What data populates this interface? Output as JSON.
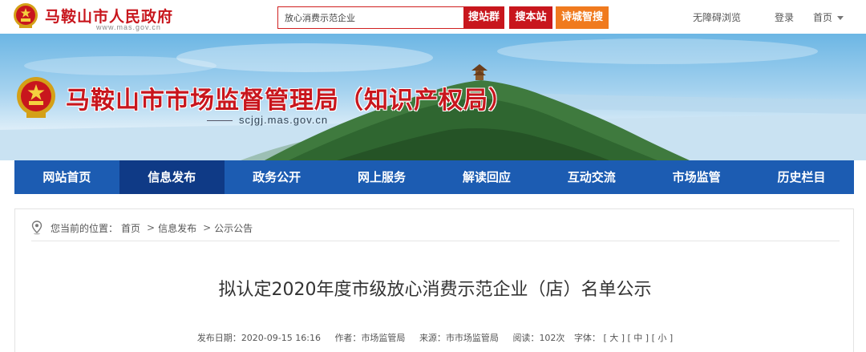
{
  "header": {
    "site_name": "马鞍山市人民政府",
    "site_domain": "www.mas.gov.cn",
    "search_value": "放心消费示范企业",
    "search_button": "搜站群",
    "site_search_button": "搜本站",
    "poetry_search_button": "诗城智搜",
    "accessibility_link": "无障碍浏览",
    "login_link": "登录",
    "home_link": "首页"
  },
  "banner": {
    "bureau_name": "马鞍山市市场监督管理局（知识产权局）",
    "bureau_domain": "scjgj.mas.gov.cn"
  },
  "nav": {
    "items": [
      {
        "label": "网站首页"
      },
      {
        "label": "信息发布"
      },
      {
        "label": "政务公开"
      },
      {
        "label": "网上服务"
      },
      {
        "label": "解读回应"
      },
      {
        "label": "互动交流"
      },
      {
        "label": "市场监管"
      },
      {
        "label": "历史栏目"
      }
    ],
    "active_index": 1
  },
  "breadcrumb": {
    "prefix": "您当前的位置：",
    "items": [
      "首页",
      "信息发布",
      "公示公告"
    ],
    "separator": ">"
  },
  "article": {
    "title": "拟认定2020年度市级放心消费示范企业（店）名单公示",
    "publish_date_label": "发布日期：",
    "publish_date": "2020-09-15 16:16",
    "author_label": "作者：",
    "author": "市场监管局",
    "source_label": "来源：",
    "source": "市市场监管局",
    "views_label": "阅读：",
    "views": "102次",
    "font_label": "字体：",
    "font_large": "[ 大 ]",
    "font_medium": "[ 中 ]",
    "font_small": "[ 小 ]"
  },
  "colors": {
    "brand_red": "#c8161d",
    "nav_blue": "#1c5cb2",
    "nav_active": "#0f3a86",
    "orange": "#f07a1e"
  }
}
